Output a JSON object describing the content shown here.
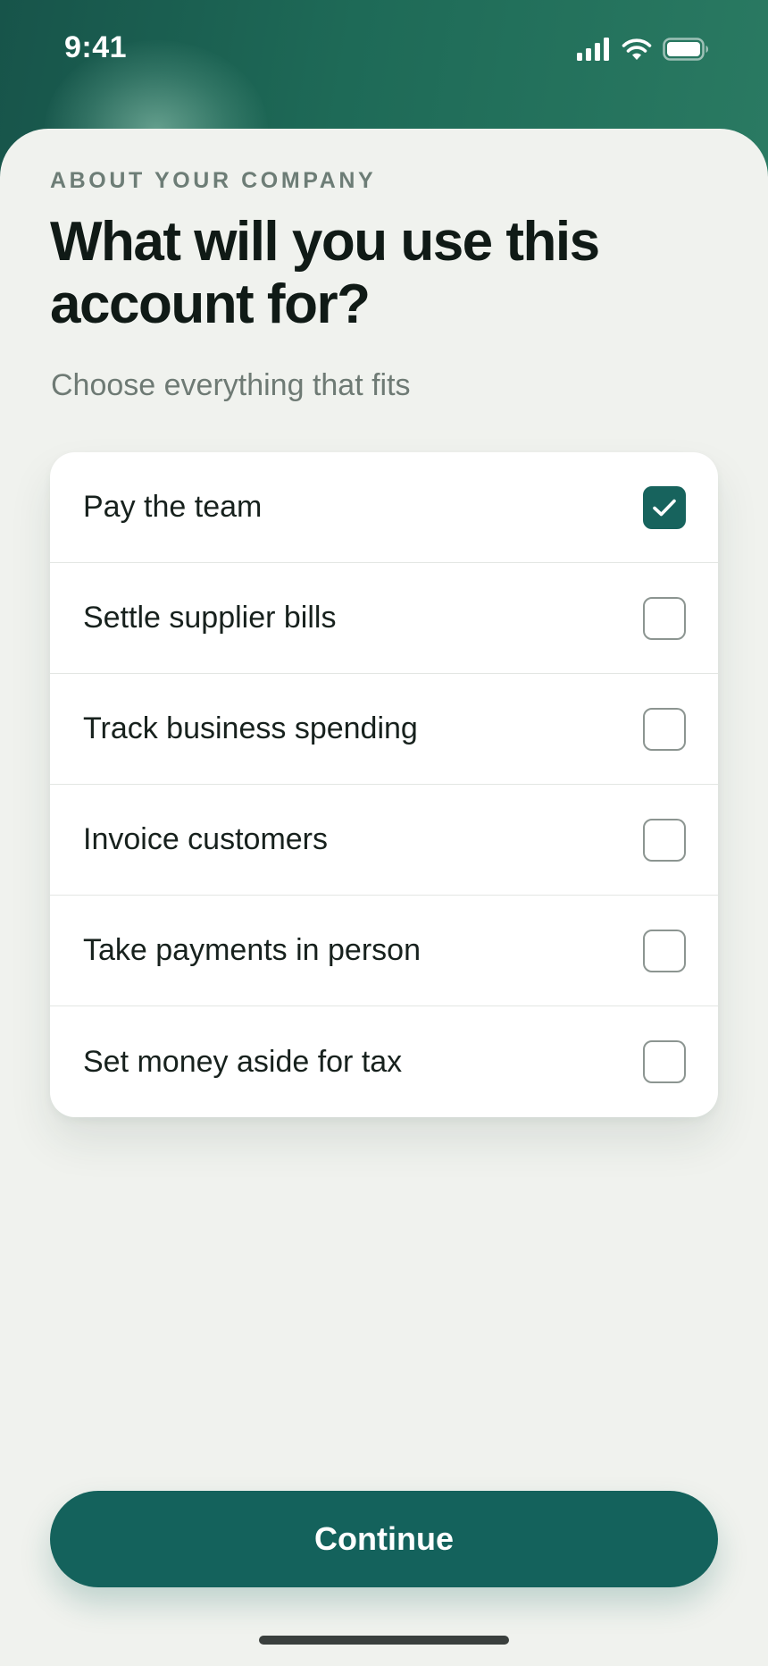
{
  "status_bar": {
    "time": "9:41"
  },
  "onboarding": {
    "eyebrow": "ABOUT YOUR COMPANY",
    "title": "What will you use this account for?",
    "subtitle": "Choose everything that fits"
  },
  "options": [
    {
      "label": "Pay the team",
      "checked": true
    },
    {
      "label": "Settle supplier bills",
      "checked": false
    },
    {
      "label": "Track business spending",
      "checked": false
    },
    {
      "label": "Invoice customers",
      "checked": false
    },
    {
      "label": "Take payments in person",
      "checked": false
    },
    {
      "label": "Set money aside for tax",
      "checked": false
    }
  ],
  "actions": {
    "continue_label": "Continue"
  },
  "colors": {
    "accent": "#14625c",
    "background": "#f0f2ee",
    "header": "#1e6a57"
  }
}
